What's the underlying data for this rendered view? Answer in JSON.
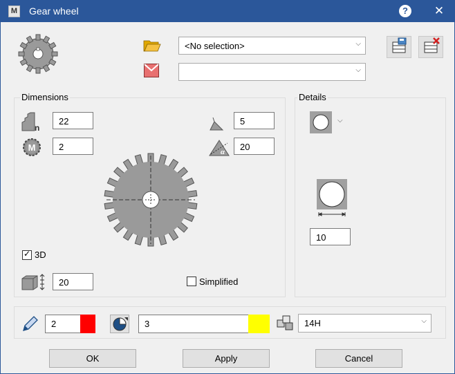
{
  "window": {
    "title": "Gear wheel",
    "app_icon_letter": "M",
    "help_glyph": "?",
    "close_glyph": "✕"
  },
  "top": {
    "template_select": {
      "value": "<No selection>"
    },
    "color_select": {
      "value": ""
    }
  },
  "dimensions": {
    "label": "Dimensions",
    "teeth": "22",
    "module": "2",
    "angle_a": "5",
    "pressure_angle": "20",
    "module_icon_letter": "M",
    "alpha_glyph": "α",
    "n_glyph": "n",
    "three_d": {
      "label": "3D",
      "checked": true
    },
    "thickness": "20",
    "simplified": {
      "label": "Simplified",
      "checked": false
    }
  },
  "details": {
    "label": "Details",
    "diameter": "10"
  },
  "bottom": {
    "pen_width": "2",
    "pen_color": "#ff0000",
    "fill_value": "3",
    "fill_color": "#ffff00",
    "fit_value": "14H"
  },
  "buttons": {
    "ok": "OK",
    "apply": "Apply",
    "cancel": "Cancel"
  },
  "glyphs": {
    "chevron": "⌵",
    "check": "✓"
  }
}
